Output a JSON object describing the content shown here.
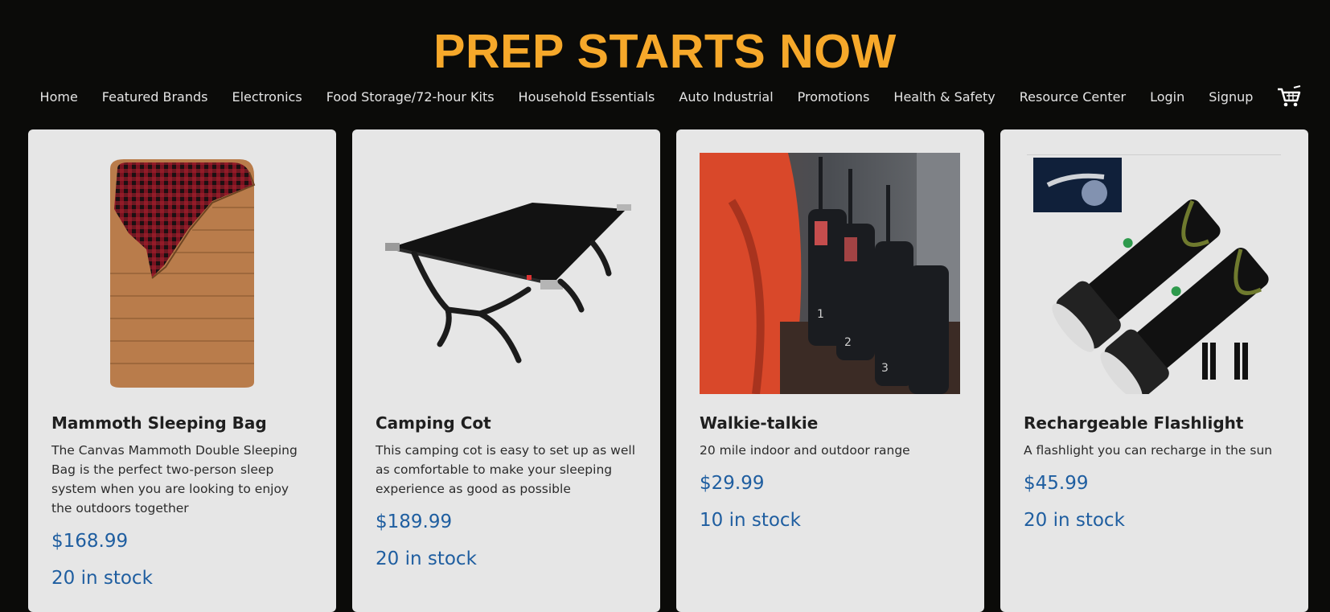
{
  "site": {
    "brand": "PREP STARTS NOW",
    "colors": {
      "brand": "#f6a82a",
      "background": "#0b0b09",
      "card": "#e6e6e6",
      "accent": "#1f5ea0"
    }
  },
  "nav": {
    "items": [
      "Home",
      "Featured Brands",
      "Electronics",
      "Food Storage/72-hour Kits",
      "Household Essentials",
      "Auto Industrial",
      "Promotions",
      "Health & Safety",
      "Resource Center",
      "Login",
      "Signup"
    ],
    "cart_icon": "shopping-cart-icon"
  },
  "products": [
    {
      "title": "Mammoth Sleeping Bag",
      "description": "The Canvas Mammoth Double Sleeping Bag is the perfect two-person sleep system when you are looking to enjoy the outdoors together",
      "price": "$168.99",
      "stock": "20 in stock",
      "image": "sleeping-bag-image"
    },
    {
      "title": "Camping Cot",
      "description": "This camping cot is easy to set up as well as comfortable to make your sleeping experience as good as possible",
      "price": "$189.99",
      "stock": "20 in stock",
      "image": "camping-cot-image"
    },
    {
      "title": "Walkie-talkie",
      "description": "20 mile indoor and outdoor range",
      "price": "$29.99",
      "stock": "10 in stock",
      "image": "walkie-talkie-image"
    },
    {
      "title": "Rechargeable Flashlight",
      "description": "A flashlight you can recharge in the sun",
      "price": "$45.99",
      "stock": "20 in stock",
      "image": "flashlight-image"
    }
  ]
}
